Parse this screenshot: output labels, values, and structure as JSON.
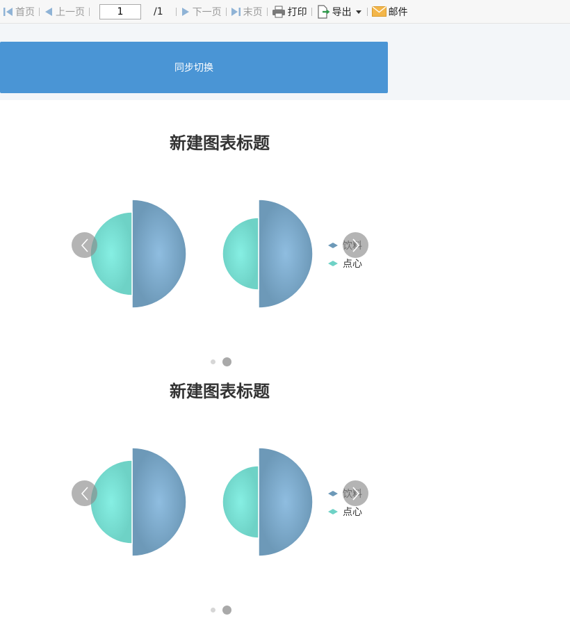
{
  "toolbar": {
    "first": "首页",
    "prev": "上一页",
    "page_value": "1",
    "total": "/1",
    "next": "下一页",
    "last": "末页",
    "print": "打印",
    "export": "导出",
    "mail": "邮件"
  },
  "sync_button": "同步切换",
  "colors": {
    "accent": "#4a95d5",
    "drink": "#6d99b8",
    "snack": "#6ed2c6"
  },
  "charts": [
    {
      "title": "新建图表标题",
      "legend": [
        {
          "label": "饮料",
          "color": "#6d99b8"
        },
        {
          "label": "点心",
          "color": "#6ed2c6"
        }
      ]
    },
    {
      "title": "新建图表标题",
      "legend": [
        {
          "label": "饮料",
          "color": "#6d99b8"
        },
        {
          "label": "点心",
          "color": "#6ed2c6"
        }
      ]
    }
  ],
  "chart_data": [
    {
      "type": "pie",
      "subtype": "rose",
      "title": "新建图表标题",
      "pies": [
        {
          "slices": [
            {
              "name": "饮料",
              "radius": 78
            },
            {
              "name": "点心",
              "radius": 60
            }
          ]
        },
        {
          "slices": [
            {
              "name": "饮料",
              "radius": 78
            },
            {
              "name": "点心",
              "radius": 52
            }
          ]
        }
      ],
      "legend": [
        "饮料",
        "点心"
      ],
      "legend_position": "right",
      "carousel_pages": 2,
      "active_page": 2
    },
    {
      "type": "pie",
      "subtype": "rose",
      "title": "新建图表标题",
      "pies": [
        {
          "slices": [
            {
              "name": "饮料",
              "radius": 78
            },
            {
              "name": "点心",
              "radius": 60
            }
          ]
        },
        {
          "slices": [
            {
              "name": "饮料",
              "radius": 78
            },
            {
              "name": "点心",
              "radius": 52
            }
          ]
        }
      ],
      "legend": [
        "饮料",
        "点心"
      ],
      "legend_position": "right",
      "carousel_pages": 2,
      "active_page": 2
    }
  ]
}
